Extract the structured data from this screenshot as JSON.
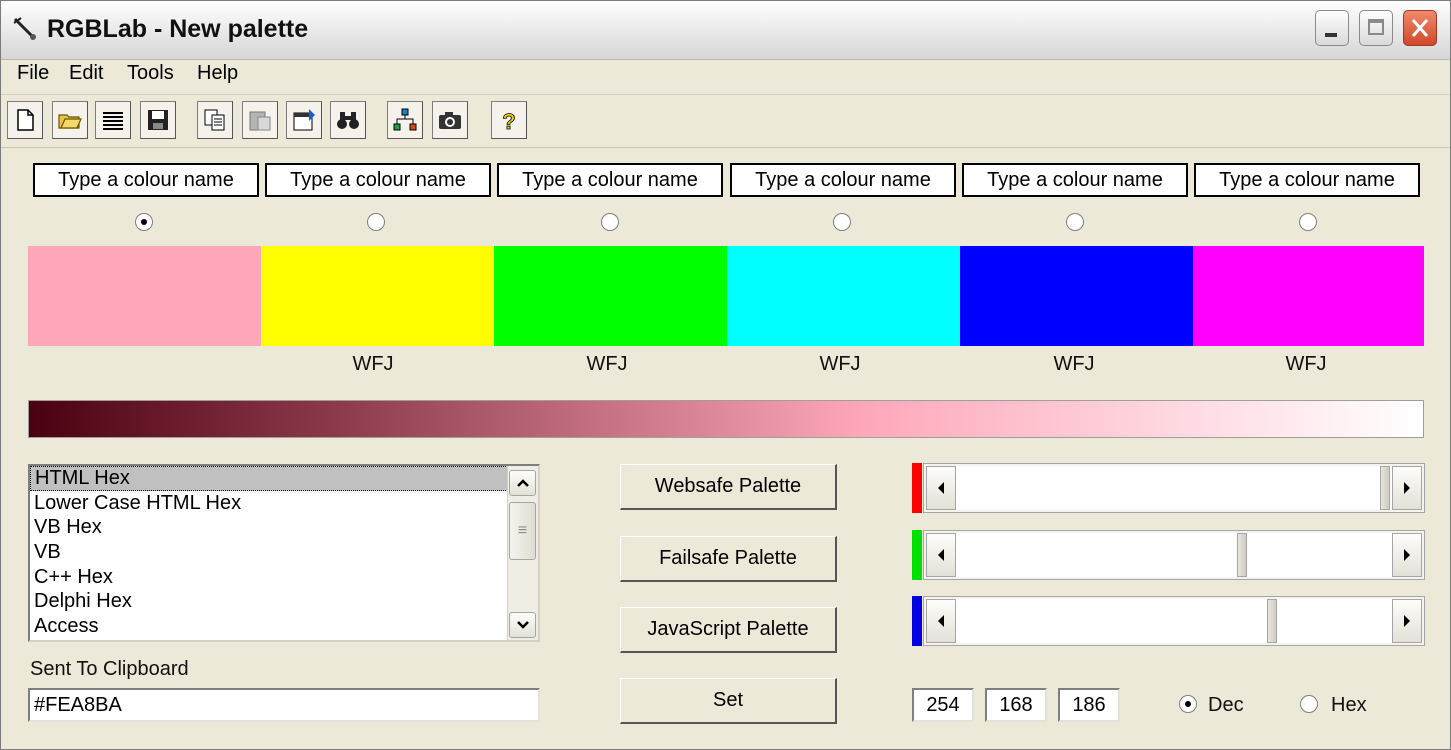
{
  "window": {
    "title": "RGBLab - New palette"
  },
  "menu": [
    "File",
    "Edit",
    "Tools",
    "Help"
  ],
  "toolbar": [
    {
      "name": "new-icon"
    },
    {
      "name": "open-folder-icon"
    },
    {
      "name": "list-icon"
    },
    {
      "name": "save-icon"
    },
    {
      "name": "copy-icon"
    },
    {
      "name": "paste-icon"
    },
    {
      "name": "properties-icon"
    },
    {
      "name": "binoculars-icon"
    },
    {
      "name": "hierarchy-icon"
    },
    {
      "name": "camera-icon"
    },
    {
      "name": "help-icon"
    }
  ],
  "palette": {
    "name_placeholder": "Type a colour name",
    "slots": [
      {
        "color": "#FEA8BA",
        "label": "",
        "selected": true
      },
      {
        "color": "#FFFF00",
        "label": "WFJ",
        "selected": false
      },
      {
        "color": "#00FF00",
        "label": "WFJ",
        "selected": false
      },
      {
        "color": "#00FFFF",
        "label": "WFJ",
        "selected": false
      },
      {
        "color": "#0000FF",
        "label": "WFJ",
        "selected": false
      },
      {
        "color": "#FF00FF",
        "label": "WFJ",
        "selected": false
      }
    ]
  },
  "format_list": {
    "items": [
      "HTML Hex",
      "Lower Case HTML Hex",
      "VB Hex",
      "VB",
      "C++ Hex",
      "Delphi Hex",
      "Access"
    ],
    "selected": "HTML Hex"
  },
  "clipboard": {
    "label": "Sent To Clipboard",
    "value": "#FEA8BA"
  },
  "buttons": {
    "websafe": "Websafe Palette",
    "failsafe": "Failsafe Palette",
    "javascript": "JavaScript Palette",
    "set": "Set"
  },
  "rgb": {
    "red": 254,
    "green": 168,
    "blue": 186
  },
  "number_format": {
    "dec_label": "Dec",
    "hex_label": "Hex",
    "selected": "Dec"
  },
  "colors": {
    "red_indicator": "#FF0000",
    "green_indicator": "#00E000",
    "blue_indicator": "#0000E0"
  }
}
